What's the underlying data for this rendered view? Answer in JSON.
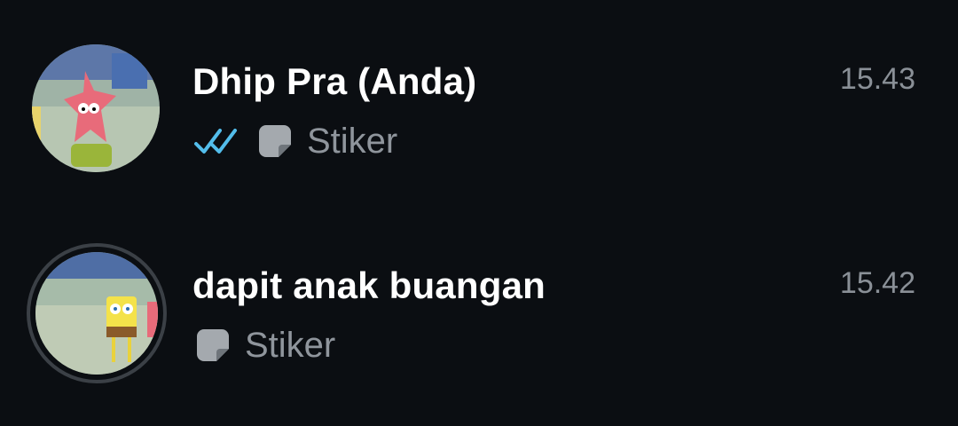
{
  "colors": {
    "background": "#0b0e12",
    "title": "#ffffff",
    "secondary": "#8f959c",
    "read_tick": "#53bdeb"
  },
  "chats": [
    {
      "name": "Dhip Pra (Anda)",
      "time": "15.43",
      "preview": "Stiker",
      "status_icon": "double-check-icon",
      "preview_icon": "sticker-icon",
      "avatar": "patrick-star-avatar"
    },
    {
      "name": "dapit anak buangan",
      "time": "15.42",
      "preview": "Stiker",
      "preview_icon": "sticker-icon",
      "avatar": "spongebob-avatar",
      "avatar_ring": true
    }
  ]
}
